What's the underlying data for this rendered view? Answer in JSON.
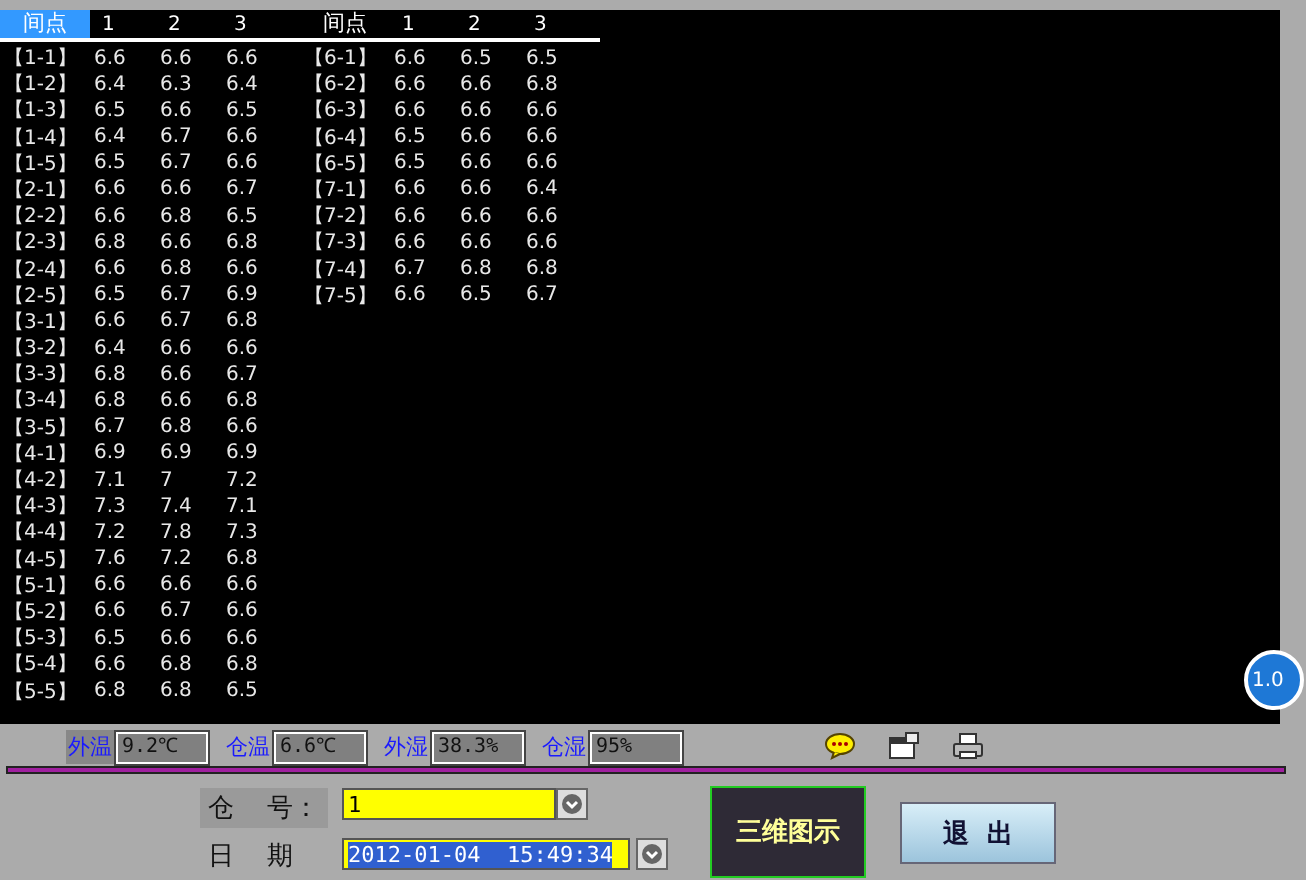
{
  "table": {
    "groups": [
      {
        "header": {
          "label": "间点",
          "selected": true
        },
        "columns": [
          "1",
          "2",
          "3"
        ],
        "rows": [
          {
            "point": "【1-1】",
            "values": [
              "6.6",
              "6.6",
              "6.6"
            ]
          },
          {
            "point": "【1-2】",
            "values": [
              "6.4",
              "6.3",
              "6.4"
            ]
          },
          {
            "point": "【1-3】",
            "values": [
              "6.5",
              "6.6",
              "6.5"
            ]
          },
          {
            "point": "【1-4】",
            "values": [
              "6.4",
              "6.7",
              "6.6"
            ]
          },
          {
            "point": "【1-5】",
            "values": [
              "6.5",
              "6.7",
              "6.6"
            ]
          },
          {
            "point": "【2-1】",
            "values": [
              "6.6",
              "6.6",
              "6.7"
            ]
          },
          {
            "point": "【2-2】",
            "values": [
              "6.6",
              "6.8",
              "6.5"
            ]
          },
          {
            "point": "【2-3】",
            "values": [
              "6.8",
              "6.6",
              "6.8"
            ]
          },
          {
            "point": "【2-4】",
            "values": [
              "6.6",
              "6.8",
              "6.6"
            ]
          },
          {
            "point": "【2-5】",
            "values": [
              "6.5",
              "6.7",
              "6.9"
            ]
          },
          {
            "point": "【3-1】",
            "values": [
              "6.6",
              "6.7",
              "6.8"
            ]
          },
          {
            "point": "【3-2】",
            "values": [
              "6.4",
              "6.6",
              "6.6"
            ]
          },
          {
            "point": "【3-3】",
            "values": [
              "6.8",
              "6.6",
              "6.7"
            ]
          },
          {
            "point": "【3-4】",
            "values": [
              "6.8",
              "6.6",
              "6.8"
            ]
          },
          {
            "point": "【3-5】",
            "values": [
              "6.7",
              "6.8",
              "6.6"
            ]
          },
          {
            "point": "【4-1】",
            "values": [
              "6.9",
              "6.9",
              "6.9"
            ]
          },
          {
            "point": "【4-2】",
            "values": [
              "7.1",
              "7",
              "7.2"
            ]
          },
          {
            "point": "【4-3】",
            "values": [
              "7.3",
              "7.4",
              "7.1"
            ]
          },
          {
            "point": "【4-4】",
            "values": [
              "7.2",
              "7.8",
              "7.3"
            ]
          },
          {
            "point": "【4-5】",
            "values": [
              "7.6",
              "7.2",
              "6.8"
            ]
          },
          {
            "point": "【5-1】",
            "values": [
              "6.6",
              "6.6",
              "6.6"
            ]
          },
          {
            "point": "【5-2】",
            "values": [
              "6.6",
              "6.7",
              "6.6"
            ]
          },
          {
            "point": "【5-3】",
            "values": [
              "6.5",
              "6.6",
              "6.6"
            ]
          },
          {
            "point": "【5-4】",
            "values": [
              "6.6",
              "6.8",
              "6.8"
            ]
          },
          {
            "point": "【5-5】",
            "values": [
              "6.8",
              "6.8",
              "6.5"
            ]
          }
        ]
      },
      {
        "header": {
          "label": "间点",
          "selected": false
        },
        "columns": [
          "1",
          "2",
          "3"
        ],
        "rows": [
          {
            "point": "【6-1】",
            "values": [
              "6.6",
              "6.5",
              "6.5"
            ]
          },
          {
            "point": "【6-2】",
            "values": [
              "6.6",
              "6.6",
              "6.8"
            ]
          },
          {
            "point": "【6-3】",
            "values": [
              "6.6",
              "6.6",
              "6.6"
            ]
          },
          {
            "point": "【6-4】",
            "values": [
              "6.5",
              "6.6",
              "6.6"
            ]
          },
          {
            "point": "【6-5】",
            "values": [
              "6.5",
              "6.6",
              "6.6"
            ]
          },
          {
            "point": "【7-1】",
            "values": [
              "6.6",
              "6.6",
              "6.4"
            ]
          },
          {
            "point": "【7-2】",
            "values": [
              "6.6",
              "6.6",
              "6.6"
            ]
          },
          {
            "point": "【7-3】",
            "values": [
              "6.6",
              "6.6",
              "6.6"
            ]
          },
          {
            "point": "【7-4】",
            "values": [
              "6.7",
              "6.8",
              "6.8"
            ]
          },
          {
            "point": "【7-5】",
            "values": [
              "6.6",
              "6.5",
              "6.7"
            ]
          }
        ]
      }
    ]
  },
  "badge": "1.0",
  "readings": [
    {
      "label": "外温",
      "value": "9.2℃",
      "selected": true
    },
    {
      "label": "仓温",
      "value": "6.6℃",
      "selected": false
    },
    {
      "label": "外湿",
      "value": "38.3%",
      "selected": false
    },
    {
      "label": "仓湿",
      "value": "95%",
      "selected": false
    }
  ],
  "form": {
    "warehouse": {
      "label": "仓    号：",
      "value": "1"
    },
    "date": {
      "label": "日    期",
      "value": "2012-01-04  15:49:34",
      "selected": true
    }
  },
  "buttons": {
    "view3d": "三维图示",
    "exit": "退  出"
  }
}
